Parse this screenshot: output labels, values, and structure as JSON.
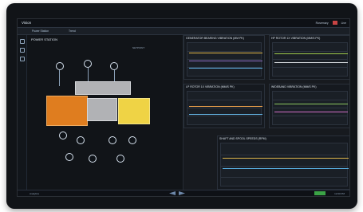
{
  "app": {
    "title": "Vision",
    "left_menu": [
      "Power Station",
      "Trend"
    ],
    "user": "Rosemary",
    "mode": "Live",
    "footer_left": "Analytics",
    "footer_right": "12:00 PM"
  },
  "panels": {
    "left_title": "POWER STATION",
    "left_sub": "NETPOINT",
    "charts": [
      {
        "title": "GENERATOR BEARING VIBRATION (µm pk)"
      },
      {
        "title": "HP ROTOR 1X VIBRATION (mm/s pk)"
      },
      {
        "title": "LP ROTOR 1X VIBRATION (mm/s pk)"
      },
      {
        "title": "WIDEBAND VIBRATION (mm/s pk)"
      },
      {
        "title": "SHAFT AND SPOOL SPEEDS (rpm)"
      }
    ]
  },
  "chart_data": [
    {
      "type": "line",
      "title": "GENERATOR BEARING VIBRATION (µm pk)",
      "series": [
        {
          "values": [
            0.6,
            0.6,
            0.7,
            0.6,
            0.62,
            0.61
          ]
        },
        {
          "values": [
            0.45,
            0.46,
            0.45,
            0.47,
            0.46,
            0.45
          ]
        },
        {
          "values": [
            0.3,
            0.31,
            0.3,
            0.29,
            0.3,
            0.31
          ]
        }
      ]
    },
    {
      "type": "line",
      "title": "HP ROTOR 1X VIBRATION (mm/s pk)",
      "series": [
        {
          "values": [
            0.7,
            0.69,
            0.71,
            0.7,
            0.69,
            0.7
          ]
        },
        {
          "values": [
            0.45,
            0.46,
            0.44,
            0.45,
            0.46,
            0.45
          ]
        }
      ]
    },
    {
      "type": "line",
      "title": "LP ROTOR 1X VIBRATION (mm/s pk)",
      "series": [
        {
          "values": [
            0.58,
            0.58,
            0.58,
            0.58,
            0.58,
            0.58
          ]
        },
        {
          "values": [
            0.4,
            0.4,
            0.41,
            0.4,
            0.39,
            0.4
          ]
        }
      ]
    },
    {
      "type": "line",
      "title": "WIDEBAND VIBRATION (mm/s pk)",
      "series": [
        {
          "values": [
            0.62,
            0.6,
            0.63,
            0.61,
            0.62,
            0.6
          ]
        },
        {
          "values": [
            0.48,
            0.48,
            0.49,
            0.48,
            0.47,
            0.48
          ]
        }
      ]
    },
    {
      "type": "line",
      "title": "SHAFT AND SPOOL SPEEDS (rpm)",
      "series": [
        {
          "values": [
            0.55,
            0.56,
            0.55,
            0.56,
            0.55,
            0.56
          ]
        },
        {
          "values": [
            0.38,
            0.39,
            0.38,
            0.39,
            0.38,
            0.39
          ]
        }
      ]
    }
  ]
}
